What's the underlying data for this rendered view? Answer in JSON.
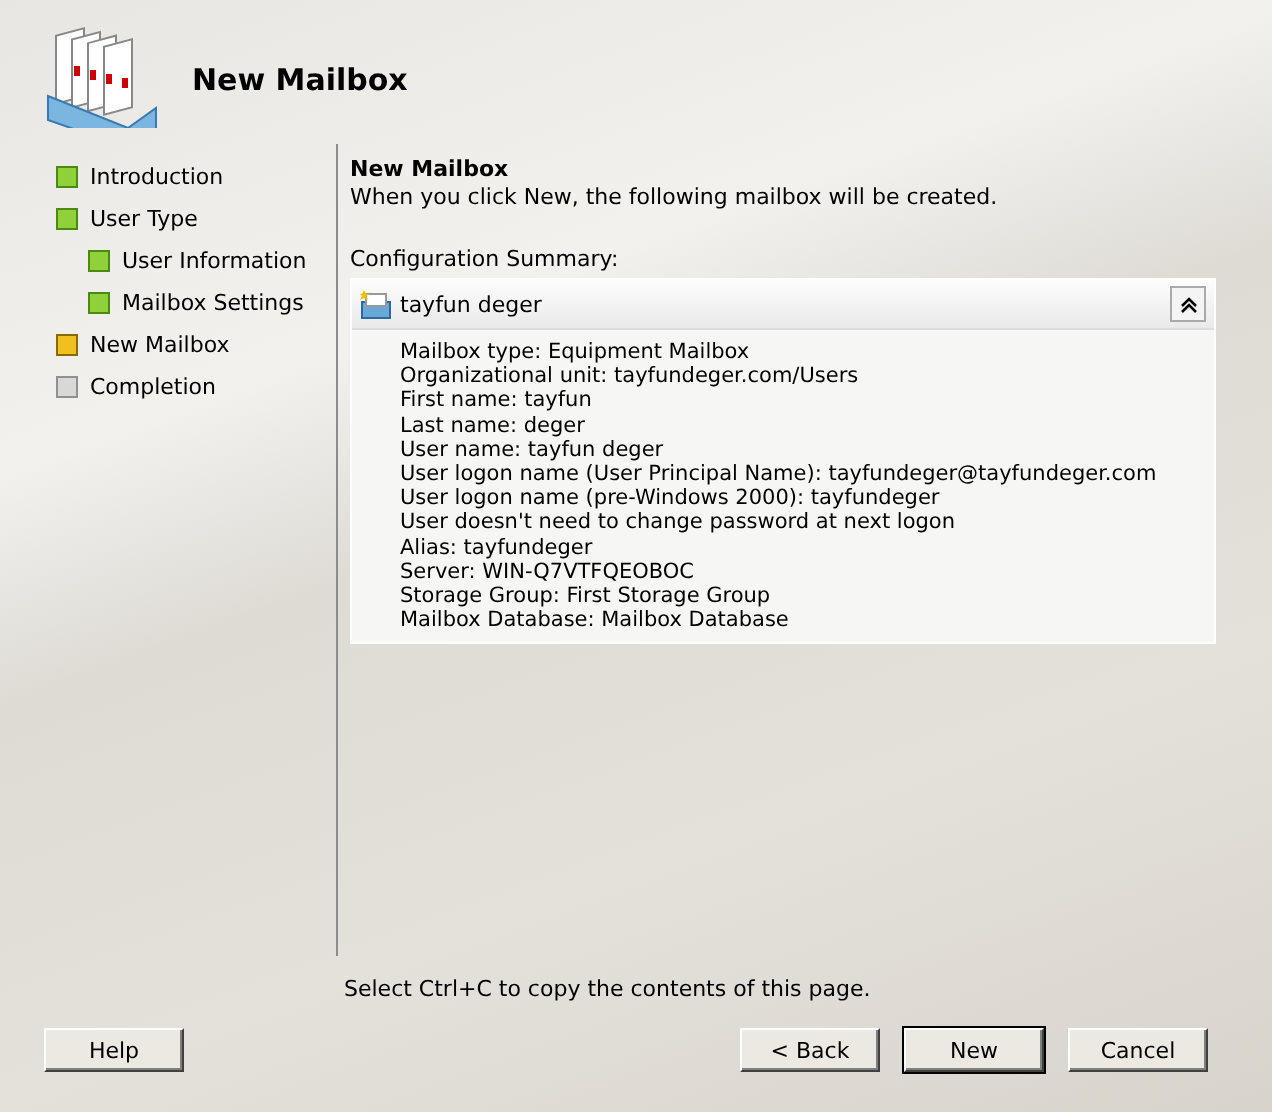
{
  "header": {
    "title": "New Mailbox"
  },
  "steps": [
    {
      "label": "Introduction",
      "completed": true,
      "current": false
    },
    {
      "label": "User Type",
      "completed": true,
      "current": false,
      "children": [
        {
          "label": "User Information",
          "completed": true,
          "current": false
        },
        {
          "label": "Mailbox Settings",
          "completed": true,
          "current": false
        }
      ]
    },
    {
      "label": "New Mailbox",
      "completed": false,
      "current": true
    },
    {
      "label": "Completion",
      "completed": false,
      "current": false
    }
  ],
  "page": {
    "heading": "New Mailbox",
    "description": "When you click New, the following mailbox will be created.",
    "summary_label": "Configuration Summary:",
    "summary": {
      "title": "tayfun deger",
      "expanded": true,
      "lines": [
        "Mailbox type: Equipment Mailbox",
        "Organizational unit: tayfundeger.com/Users",
        "First name: tayfun",
        "Last name: deger",
        "User name: tayfun deger",
        "User logon name (User Principal Name): tayfundeger@tayfundeger.com",
        "User logon name (pre-Windows 2000): tayfundeger",
        "User doesn't need to change password at next logon",
        "Alias: tayfundeger",
        "Server: WIN-Q7VTFQEOBOC",
        "Storage Group: First Storage Group",
        "Mailbox Database: Mailbox Database"
      ]
    }
  },
  "hint": "Select Ctrl+C to copy the contents of this page.",
  "buttons": [
    {
      "label": "Help",
      "kind": "help",
      "default": false
    },
    {
      "label": "< Back",
      "kind": "nav",
      "default": false
    },
    {
      "label": "New",
      "kind": "nav",
      "default": true
    },
    {
      "label": "Cancel",
      "kind": "nav",
      "default": false
    }
  ]
}
